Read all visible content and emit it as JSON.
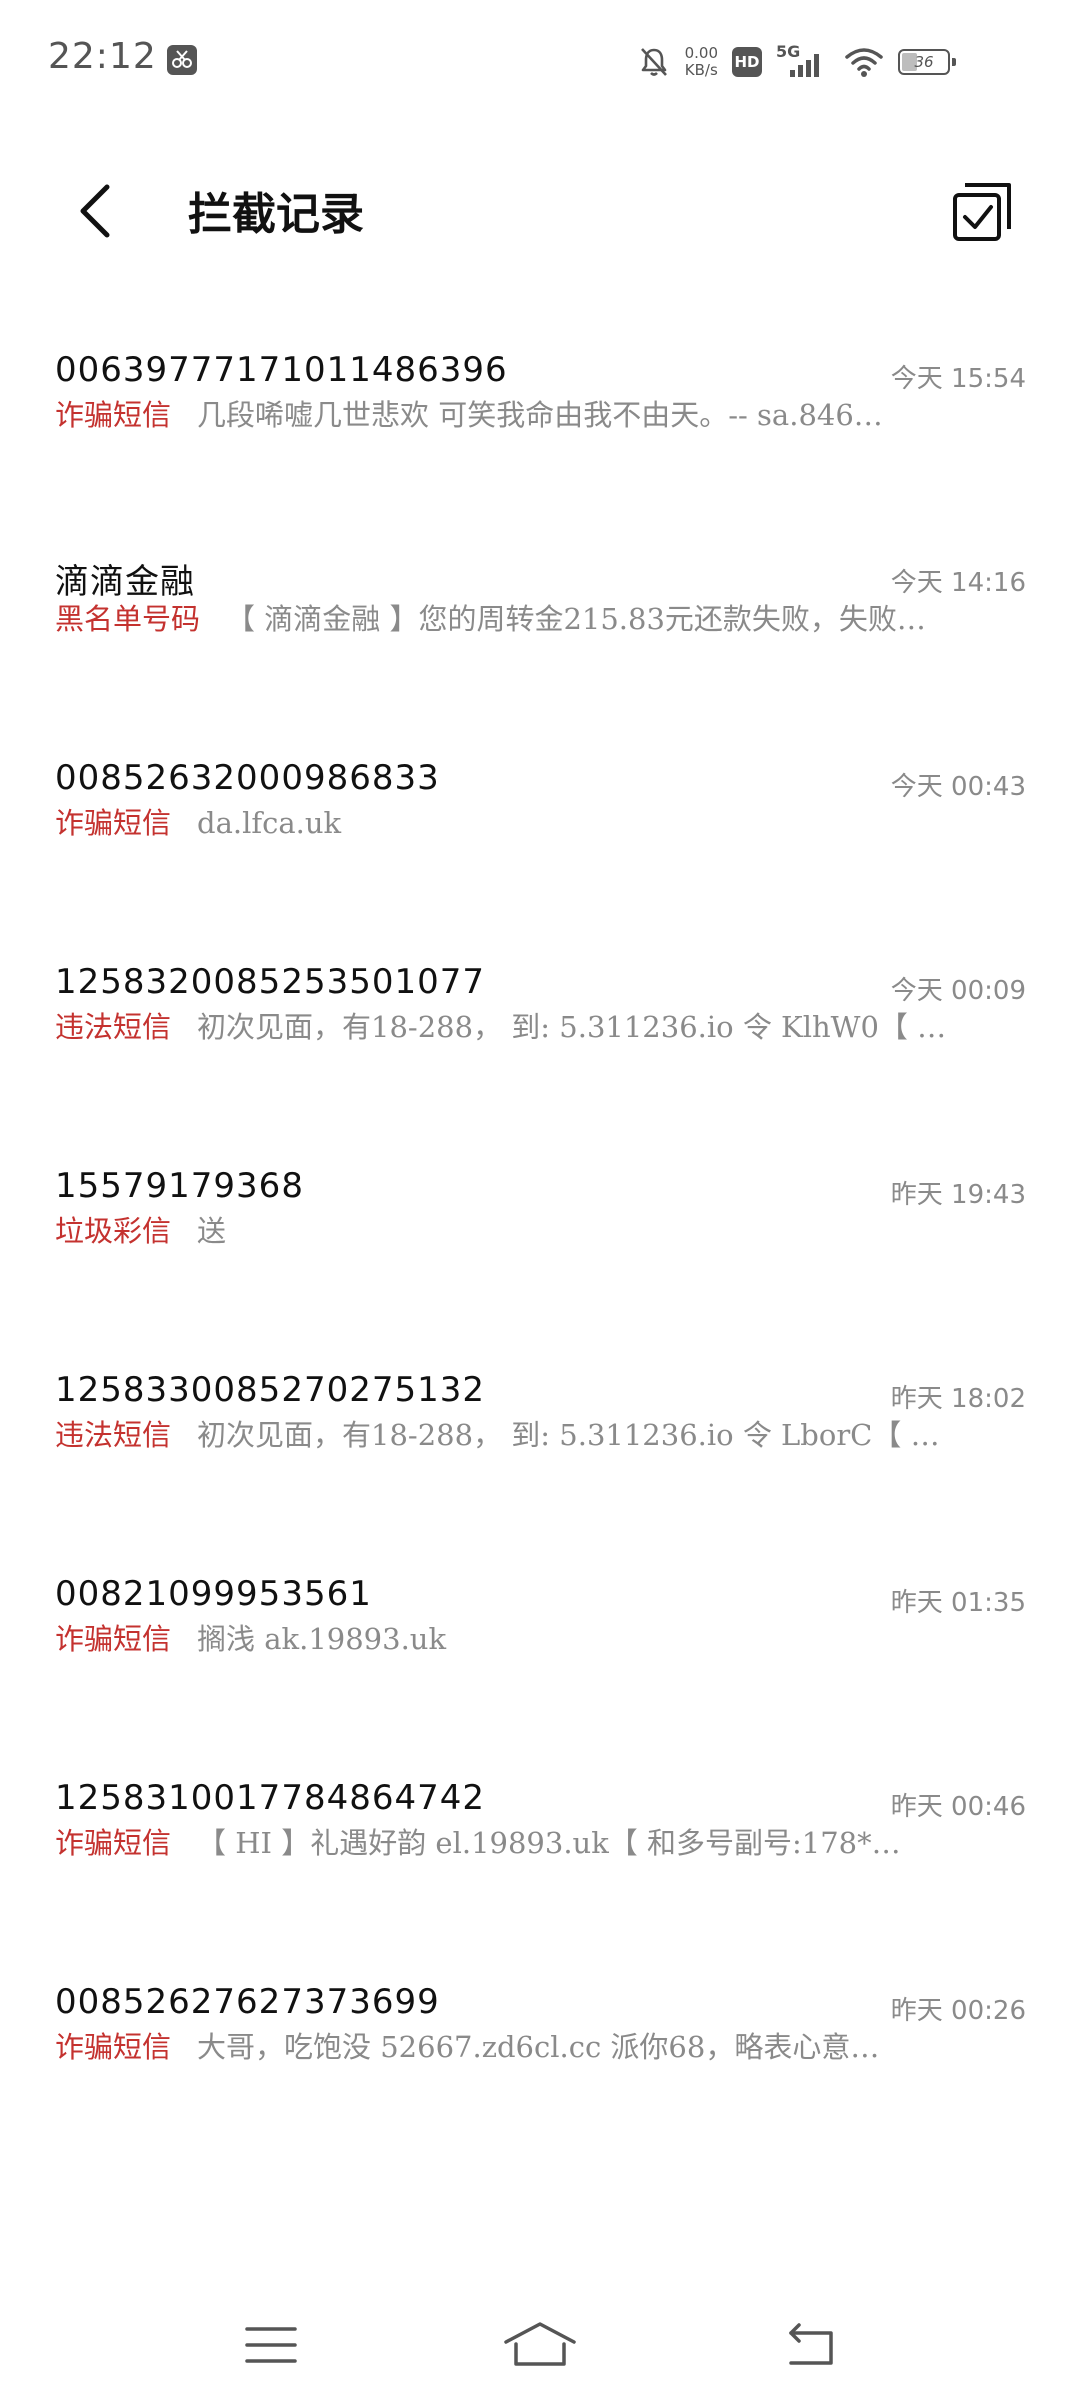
{
  "status_bar": {
    "time": "22:12",
    "net_speed_value": "0.00",
    "net_speed_unit": "KB/s",
    "hd_label": "HD",
    "network_label": "5G",
    "battery_level": 36,
    "battery_text": "36",
    "icons": [
      "screenshot-icon",
      "mute-icon",
      "hd-icon",
      "signal-icon",
      "wifi-icon",
      "battery-icon"
    ]
  },
  "header": {
    "title": "拦截记录",
    "back_icon": "chevron-left-icon",
    "edit_icon": "edit-check-icon"
  },
  "records": [
    {
      "sender": "00639777171011486396",
      "time": "今天 15:54",
      "category": "诈骗短信",
      "preview": "几段唏嘘几世悲欢 可笑我命由我不由天。-- sa.846…"
    },
    {
      "sender": "滴滴金融",
      "time": "今天 14:16",
      "category": "黑名单号码",
      "preview": "【 滴滴金融 】您的周转金215.83元还款失败，失败…"
    },
    {
      "sender": "00852632000986833",
      "time": "今天 00:43",
      "category": "诈骗短信",
      "preview": "da.lfca.uk"
    },
    {
      "sender": "1258320085253501077",
      "time": "今天 00:09",
      "category": "违法短信",
      "preview": "初次见面，有18-288， 到: 5.311236.io 令 KlhW0【 …"
    },
    {
      "sender": "15579179368",
      "time": "昨天 19:43",
      "category": "垃圾彩信",
      "preview": "送"
    },
    {
      "sender": "1258330085270275132",
      "time": "昨天 18:02",
      "category": "违法短信",
      "preview": "初次见面，有18-288， 到: 5.311236.io 令 LborC【 …"
    },
    {
      "sender": "00821099953561",
      "time": "昨天 01:35",
      "category": "诈骗短信",
      "preview": "搁浅 ak.19893.uk"
    },
    {
      "sender": "1258310017784864742",
      "time": "昨天 00:46",
      "category": "诈骗短信",
      "preview": "【 HI 】礼遇好韵 el.19893.uk【 和多号副号:178*…"
    },
    {
      "sender": "00852627627373699",
      "time": "昨天 00:26",
      "category": "诈骗短信",
      "preview": "大哥，吃饱没 52667.zd6cl.cc 派你68，略表心意…"
    }
  ],
  "nav_bar": {
    "menu_icon": "menu-icon",
    "home_icon": "home-icon",
    "back_icon": "back-arrow-icon"
  },
  "colors": {
    "accent_red": "#c4322f",
    "text_primary": "#111111",
    "text_secondary": "#8a8a8a",
    "icon_gray": "#555555"
  }
}
